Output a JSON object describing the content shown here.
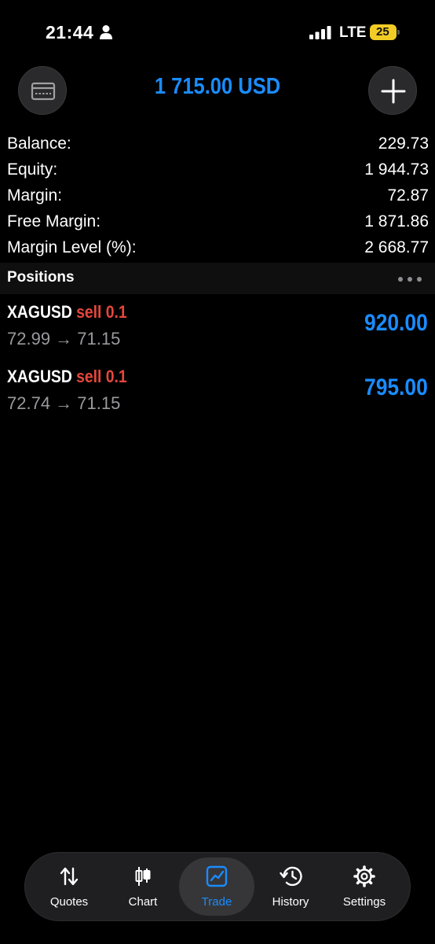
{
  "status_bar": {
    "time": "21:44",
    "network": "LTE",
    "battery": "25"
  },
  "header": {
    "title": "1 715.00 USD"
  },
  "summary": [
    {
      "label": "Balance:",
      "value": "229.73"
    },
    {
      "label": "Equity:",
      "value": "1 944.73"
    },
    {
      "label": "Margin:",
      "value": "72.87"
    },
    {
      "label": "Free Margin:",
      "value": "1 871.86"
    },
    {
      "label": "Margin Level (%):",
      "value": "2 668.77"
    }
  ],
  "positions": {
    "title": "Positions",
    "items": [
      {
        "symbol": "XAGUSD",
        "side": "sell 0.1",
        "prices": "72.99 → 71.15",
        "profit": "920.00"
      },
      {
        "symbol": "XAGUSD",
        "side": "sell 0.1",
        "prices": "72.74 → 71.15",
        "profit": "795.00"
      }
    ]
  },
  "tabs": [
    {
      "label": "Quotes",
      "icon": "quotes-icon"
    },
    {
      "label": "Chart",
      "icon": "chart-icon"
    },
    {
      "label": "Trade",
      "icon": "trade-icon"
    },
    {
      "label": "History",
      "icon": "history-icon"
    },
    {
      "label": "Settings",
      "icon": "settings-icon"
    }
  ],
  "colors": {
    "accent": "#1a8cff",
    "sell": "#e7473c",
    "battery": "#f2cc25"
  }
}
